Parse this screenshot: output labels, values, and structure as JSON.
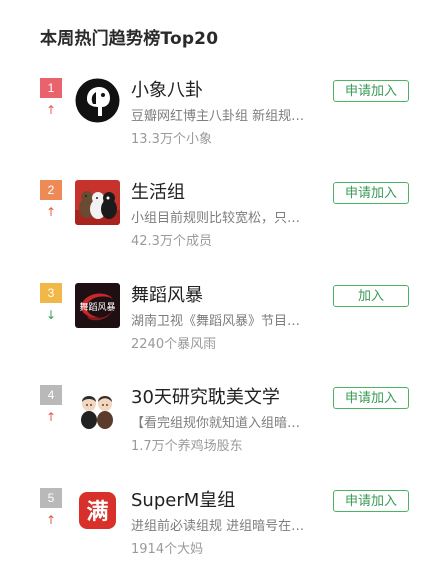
{
  "title": "本周热门趋势榜Top20",
  "colors": {
    "rank1": "#e8636b",
    "rank2": "#ee8a56",
    "rank3": "#f2b847",
    "rank_other": "#b9b9b9",
    "trend_up": "#e45a4d",
    "trend_down": "#3a9a56",
    "join_green": "#3a9a56"
  },
  "groups": [
    {
      "rank": "1",
      "trend": "↑",
      "name": "小象八卦",
      "desc": "豆瓣网红博主八卦组 新组规…",
      "members": "13.3万个小象",
      "button": "申请加入"
    },
    {
      "rank": "2",
      "trend": "↑",
      "name": "生活组",
      "desc": "小组目前规则比较宽松，只…",
      "members": "42.3万个成员",
      "button": "申请加入"
    },
    {
      "rank": "3",
      "trend": "↓",
      "name": "舞蹈风暴",
      "desc": "湖南卫视《舞蹈风暴》节目…",
      "members": "2240个暴风雨",
      "button": "加入"
    },
    {
      "rank": "4",
      "trend": "↑",
      "name": "30天研究耽美文学",
      "desc": "【看完组规你就知道入组暗…",
      "members": "1.7万个养鸡场股东",
      "button": "申请加入"
    },
    {
      "rank": "5",
      "trend": "↑",
      "name": "SuperM皇组",
      "desc": "进组前必读组规 进组暗号在…",
      "members": "1914个大妈",
      "button": "申请加入"
    }
  ],
  "avatar_icons": [
    "elephant-logo-icon",
    "bears-photo-icon",
    "dance-storm-logo-icon",
    "cartoon-couple-icon",
    "man-character-icon"
  ],
  "avatar_logo_text": {
    "dance": "舞蹈风暴",
    "man": "满"
  }
}
